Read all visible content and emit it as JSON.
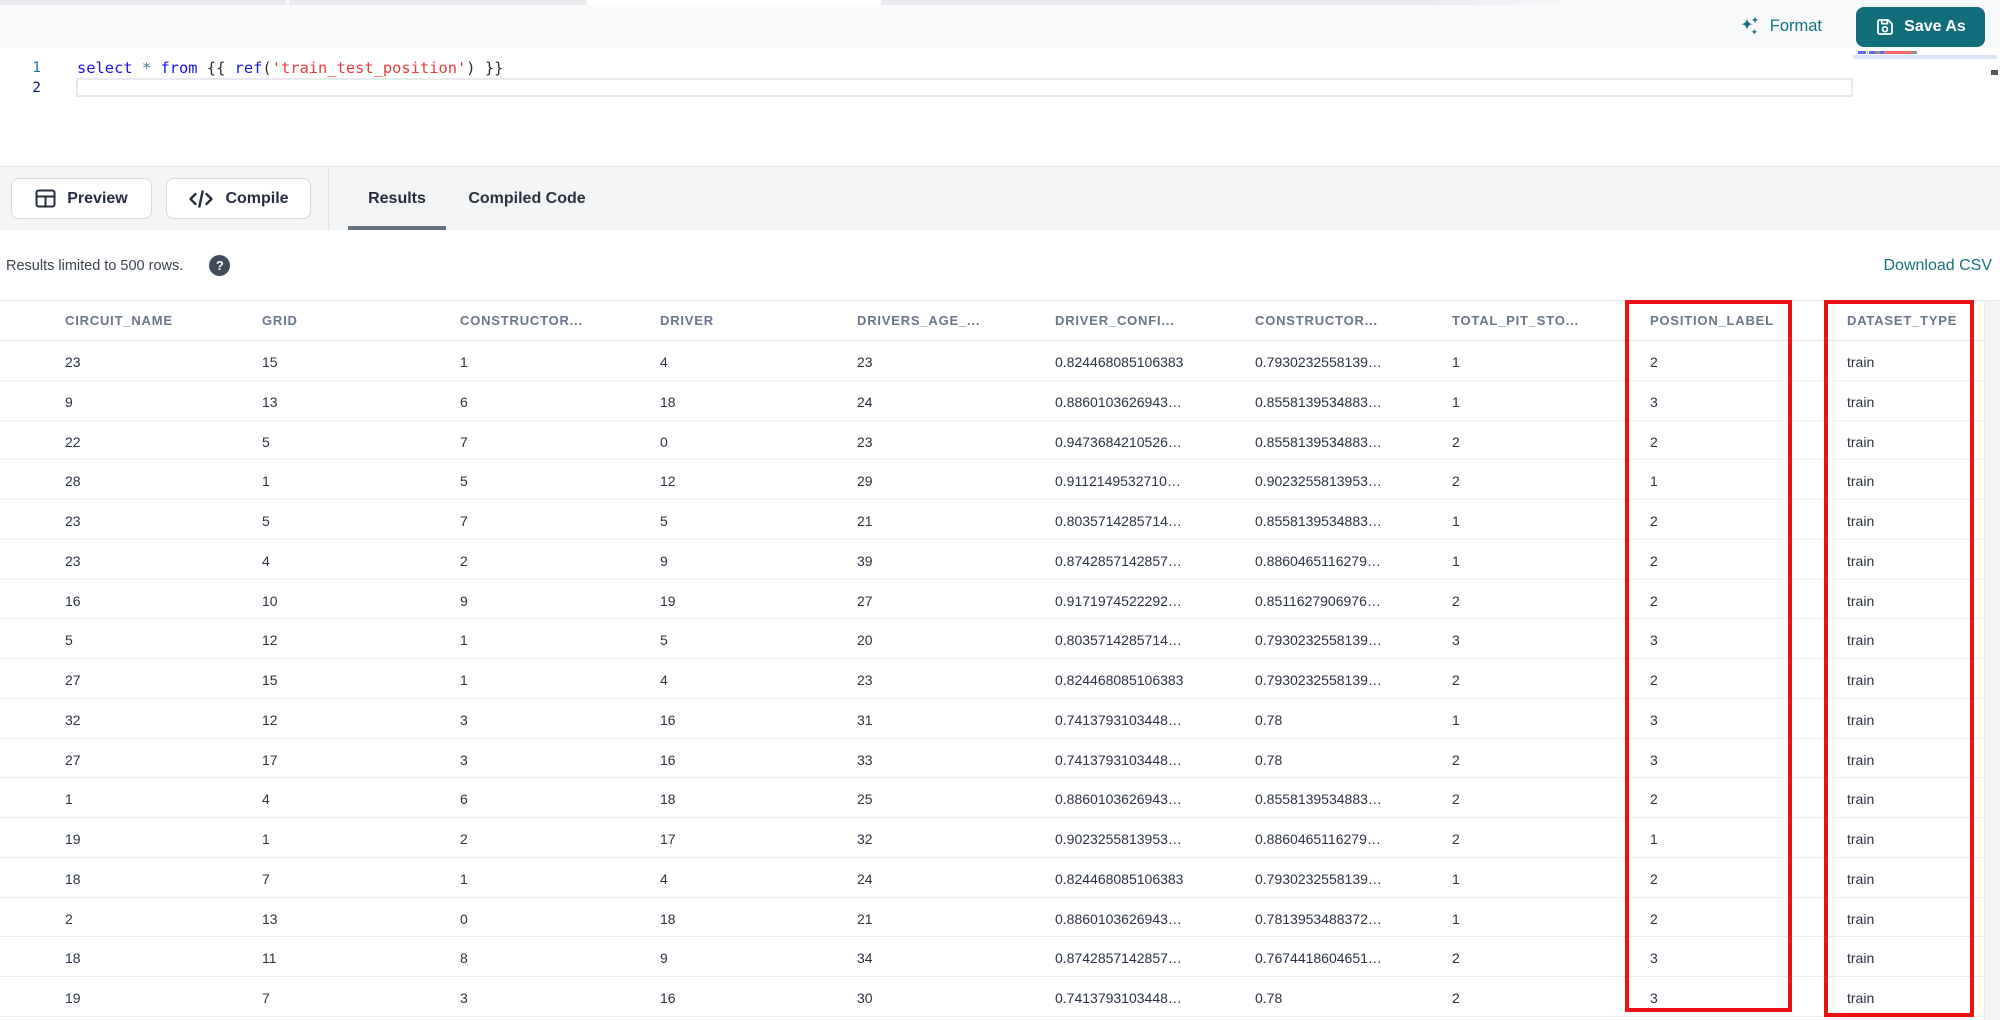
{
  "editor": {
    "line_numbers": [
      "1",
      "2"
    ],
    "code_line": "select * from {{ ref('train_test_position') }}",
    "code_tokens": [
      {
        "text": "select",
        "type": "keyword"
      },
      {
        "text": " ",
        "type": "punct"
      },
      {
        "text": "*",
        "type": "operator"
      },
      {
        "text": " ",
        "type": "punct"
      },
      {
        "text": "from",
        "type": "keyword"
      },
      {
        "text": " {{ ",
        "type": "punct"
      },
      {
        "text": "ref",
        "type": "keyword"
      },
      {
        "text": "(",
        "type": "punct"
      },
      {
        "text": "'train_test_position'",
        "type": "string"
      },
      {
        "text": ")",
        "type": "punct"
      },
      {
        "text": " }}",
        "type": "punct"
      }
    ],
    "format_button": "Format",
    "save_as_button": "Save As"
  },
  "toolbar": {
    "preview_button": "Preview",
    "compile_button": "Compile",
    "tabs": [
      {
        "label": "Results",
        "active": true
      },
      {
        "label": "Compiled Code",
        "active": false
      }
    ]
  },
  "results_bar": {
    "info": "Results limited to 500 rows.",
    "help_icon": "?",
    "download_link": "Download CSV"
  },
  "table": {
    "columns": [
      "CIRCUIT_NAME",
      "GRID",
      "CONSTRUCTOR...",
      "DRIVER",
      "DRIVERS_AGE_...",
      "DRIVER_CONFI...",
      "CONSTRUCTOR...",
      "TOTAL_PIT_STO...",
      "POSITION_LABEL",
      "DATASET_TYPE"
    ],
    "rows": [
      [
        "23",
        "15",
        "1",
        "4",
        "23",
        "0.824468085106383",
        "0.7930232558139…",
        "1",
        "2",
        "train"
      ],
      [
        "9",
        "13",
        "6",
        "18",
        "24",
        "0.8860103626943…",
        "0.8558139534883…",
        "1",
        "3",
        "train"
      ],
      [
        "22",
        "5",
        "7",
        "0",
        "23",
        "0.9473684210526…",
        "0.8558139534883…",
        "2",
        "2",
        "train"
      ],
      [
        "28",
        "1",
        "5",
        "12",
        "29",
        "0.9112149532710…",
        "0.9023255813953…",
        "2",
        "1",
        "train"
      ],
      [
        "23",
        "5",
        "7",
        "5",
        "21",
        "0.8035714285714…",
        "0.8558139534883…",
        "1",
        "2",
        "train"
      ],
      [
        "23",
        "4",
        "2",
        "9",
        "39",
        "0.8742857142857…",
        "0.8860465116279…",
        "1",
        "2",
        "train"
      ],
      [
        "16",
        "10",
        "9",
        "19",
        "27",
        "0.9171974522292…",
        "0.8511627906976…",
        "2",
        "2",
        "train"
      ],
      [
        "5",
        "12",
        "1",
        "5",
        "20",
        "0.8035714285714…",
        "0.7930232558139…",
        "3",
        "3",
        "train"
      ],
      [
        "27",
        "15",
        "1",
        "4",
        "23",
        "0.824468085106383",
        "0.7930232558139…",
        "2",
        "2",
        "train"
      ],
      [
        "32",
        "12",
        "3",
        "16",
        "31",
        "0.7413793103448…",
        "0.78",
        "1",
        "3",
        "train"
      ],
      [
        "27",
        "17",
        "3",
        "16",
        "33",
        "0.7413793103448…",
        "0.78",
        "2",
        "3",
        "train"
      ],
      [
        "1",
        "4",
        "6",
        "18",
        "25",
        "0.8860103626943…",
        "0.8558139534883…",
        "2",
        "2",
        "train"
      ],
      [
        "19",
        "1",
        "2",
        "17",
        "32",
        "0.9023255813953…",
        "0.8860465116279…",
        "2",
        "1",
        "train"
      ],
      [
        "18",
        "7",
        "1",
        "4",
        "24",
        "0.824468085106383",
        "0.7930232558139…",
        "1",
        "2",
        "train"
      ],
      [
        "2",
        "13",
        "0",
        "18",
        "21",
        "0.8860103626943…",
        "0.7813953488372…",
        "1",
        "2",
        "train"
      ],
      [
        "18",
        "11",
        "8",
        "9",
        "34",
        "0.8742857142857…",
        "0.7674418604651…",
        "2",
        "3",
        "train"
      ],
      [
        "19",
        "7",
        "3",
        "16",
        "30",
        "0.7413793103448…",
        "0.78",
        "2",
        "3",
        "train"
      ]
    ]
  },
  "annotations": {
    "highlighted_columns": [
      "POSITION_LABEL",
      "DATASET_TYPE"
    ],
    "color": "#ee1111"
  },
  "colors": {
    "accent_teal": "#116e7a",
    "link_teal": "#1b7987",
    "keyword_blue": "#1414ee",
    "string_red": "#e83c3c",
    "operator_slate": "#5e7a8e",
    "line_number_default": "#237893",
    "line_number_active": "#0b216f",
    "toolbar_gray": "#f3f4f6",
    "annotation_red": "#ee1111"
  }
}
